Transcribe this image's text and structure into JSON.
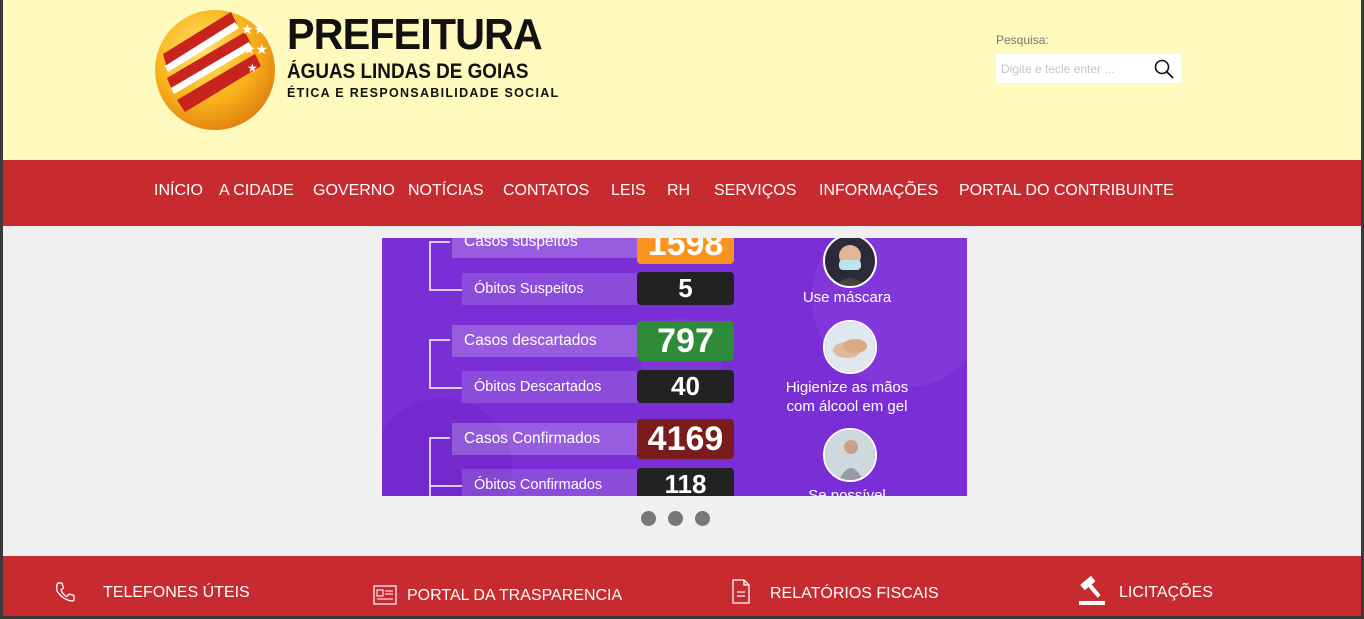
{
  "header": {
    "logo": {
      "title": "PREFEITURA",
      "subtitle": "ÁGUAS LINDAS DE GOIAS",
      "tagline": "ÉTICA E RESPONSABILIDADE SOCIAL"
    },
    "search": {
      "label": "Pesquisa:",
      "placeholder": "Digite e tecle enter ...",
      "icon": "search-icon"
    }
  },
  "nav": {
    "items": [
      {
        "label": "INÍCIO"
      },
      {
        "label": "A CIDADE"
      },
      {
        "label": "GOVERNO"
      },
      {
        "label": "NOTÍCIAS"
      },
      {
        "label": "CONTATOS"
      },
      {
        "label": "LEIS"
      },
      {
        "label": "RH"
      },
      {
        "label": "SERVIÇOS"
      },
      {
        "label": "INFORMAÇÕES"
      },
      {
        "label": "PORTAL DO CONTRIBUINTE"
      }
    ]
  },
  "slider": {
    "rows": [
      {
        "label": "Casos suspeitos",
        "value": "1598",
        "color": "#f7931e"
      },
      {
        "label": "Óbitos Suspeitos",
        "value": "5",
        "color": "#222222"
      },
      {
        "label": "Casos descartados",
        "value": "797",
        "color": "#2e8b3a"
      },
      {
        "label": "Óbitos Descartados",
        "value": "40",
        "color": "#222222"
      },
      {
        "label": "Casos Confirmados",
        "value": "4169",
        "color": "#7b1c1c"
      },
      {
        "label": "Óbitos Confirmados",
        "value": "118",
        "color": "#222222"
      }
    ],
    "tips": [
      {
        "text": "Use máscara"
      },
      {
        "line1": "Higienize as mãos",
        "line2": "com álcool em gel"
      },
      {
        "text": "Se possível"
      }
    ],
    "dots": 3
  },
  "footer": {
    "items": [
      {
        "label": "TELEFONES  ÚTEIS",
        "icon": "phone-icon"
      },
      {
        "label": "PORTAL DA  TRASPARENCIA",
        "icon": "newspaper-icon"
      },
      {
        "label": "RELATÓRIOS FISCAIS",
        "icon": "document-icon"
      },
      {
        "label": "LICITAÇÕES",
        "icon": "gavel-icon"
      }
    ]
  },
  "colors": {
    "header_bg": "#fefabd",
    "brand_red": "#c72b30",
    "slider_purple": "#7a2fd6",
    "page_bg": "#f0f0f0"
  }
}
